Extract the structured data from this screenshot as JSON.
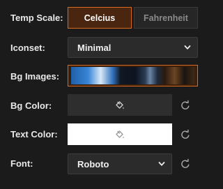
{
  "temp_scale": {
    "label": "Temp Scale:",
    "options": [
      "Celcius",
      "Fahrenheit"
    ],
    "selected": "Celcius"
  },
  "iconset": {
    "label": "Iconset:",
    "value": "Minimal"
  },
  "bg_images": {
    "label": "Bg Images:"
  },
  "bg_color": {
    "label": "Bg Color:",
    "swatch_color": "#2e2e2e"
  },
  "text_color": {
    "label": "Text Color:",
    "swatch_color": "#ffffff"
  },
  "font": {
    "label": "Font:",
    "value": "Roboto"
  },
  "colors": {
    "background": "#1b1b1b",
    "accent": "#d96a1f"
  },
  "icons": {
    "dropdown": "chevron-down-icon",
    "fill": "paint-bucket-icon",
    "reset": "refresh-icon"
  }
}
